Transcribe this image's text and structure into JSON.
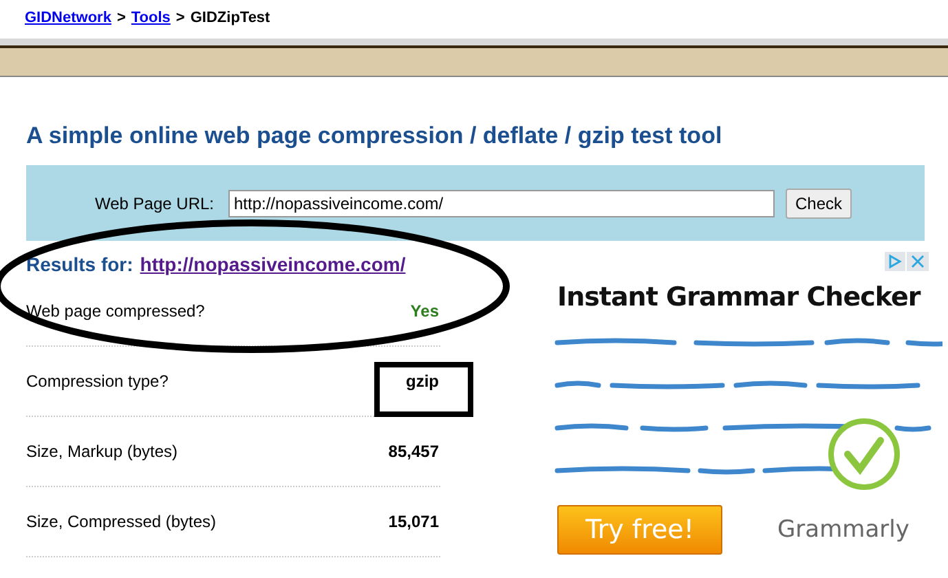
{
  "breadcrumb": {
    "links": [
      "GIDNetwork",
      "Tools"
    ],
    "separator": ">",
    "current": "GIDZipTest"
  },
  "heading": "A simple online web page compression / deflate / gzip test tool",
  "form": {
    "label": "Web Page URL:",
    "value": "http://nopassiveincome.com/",
    "button": "Check"
  },
  "results": {
    "label": "Results for:",
    "url": "http://nopassiveincome.com/"
  },
  "rows": [
    {
      "label": "Web page compressed?",
      "value": "Yes",
      "kind": "status"
    },
    {
      "label": "Compression type?",
      "value": "gzip",
      "kind": "highlighted"
    },
    {
      "label": "Size, Markup (bytes)",
      "value": "85,457",
      "kind": "plain"
    },
    {
      "label": "Size, Compressed (bytes)",
      "value": "15,071",
      "kind": "plain"
    }
  ],
  "ad": {
    "headline": "Instant Grammar Checker",
    "button": "Try free!",
    "brand": "Grammarly"
  }
}
